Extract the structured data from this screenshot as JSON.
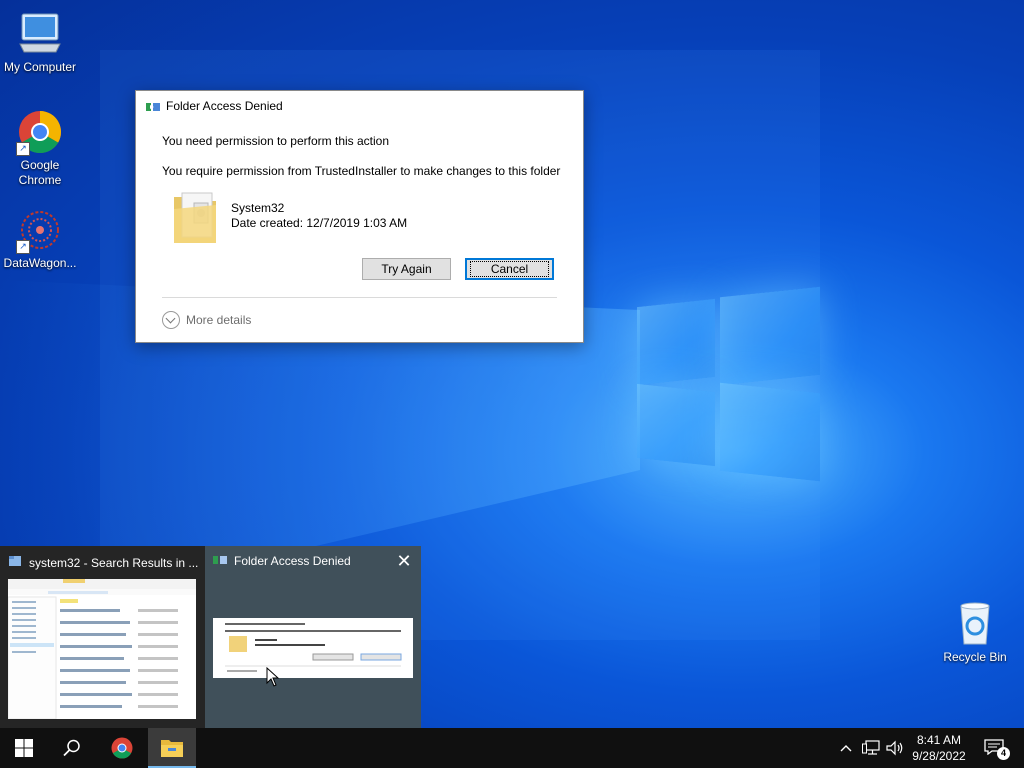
{
  "desktop": {
    "icons": [
      {
        "label": "My Computer",
        "icon": "computer-icon"
      },
      {
        "label": "Google\nChrome",
        "icon": "chrome-icon"
      },
      {
        "label": "DataWagon...",
        "icon": "datawagon-icon"
      },
      {
        "label": "Recycle Bin",
        "icon": "recycle-bin-icon"
      }
    ]
  },
  "dialog": {
    "title": "Folder Access Denied",
    "message": "You need permission to perform this action",
    "detail": "You require permission from TrustedInstaller to make changes to this folder",
    "folder_name": "System32",
    "date_created": "Date created: 12/7/2019 1:03 AM",
    "try_again_label": "Try Again",
    "cancel_label": "Cancel",
    "more_details_label": "More details"
  },
  "thumbnails": {
    "explorer_title": "system32 - Search Results in ...",
    "dialog_title": "Folder Access Denied",
    "close_glyph": "✕"
  },
  "taskbar": {
    "time": "8:41 AM",
    "date": "9/28/2022",
    "notification_count": "4"
  },
  "colors": {
    "accent": "#0078d7",
    "taskbar": "#101010"
  }
}
